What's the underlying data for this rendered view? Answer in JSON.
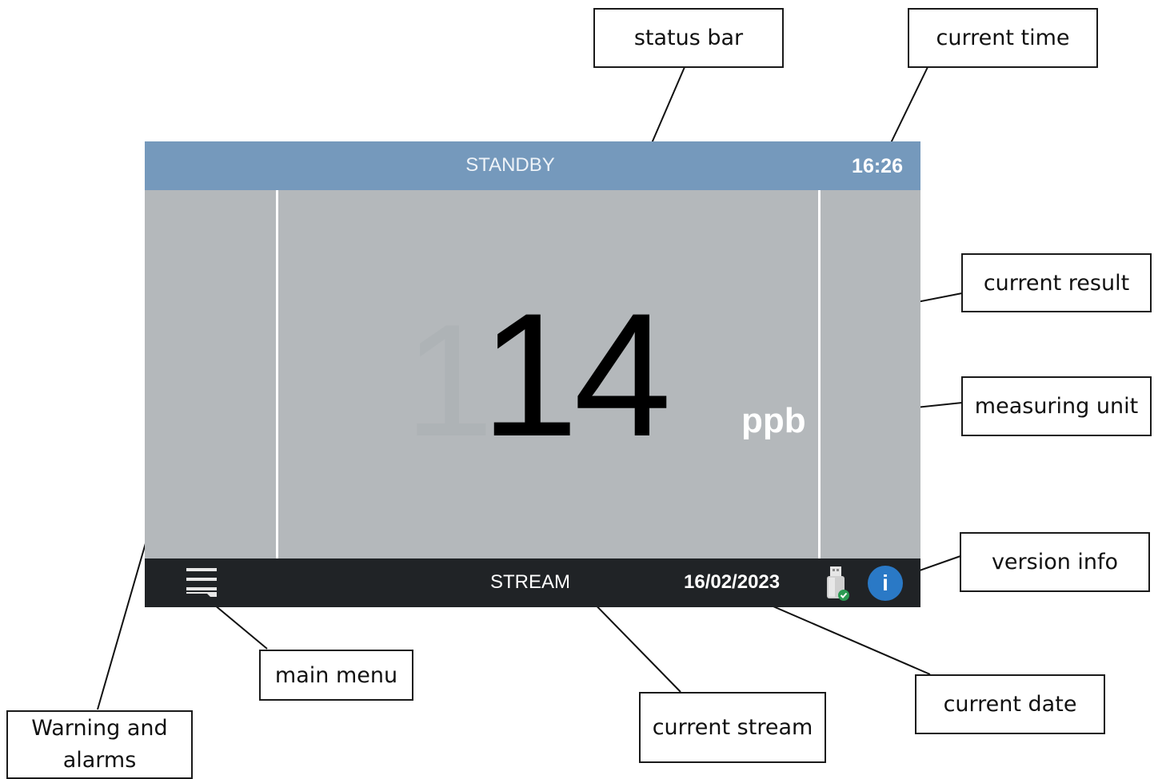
{
  "status_bar": {
    "status": "STANDBY",
    "time": "16:26",
    "color": "#7599bc"
  },
  "main": {
    "ghost_digit": "1",
    "result": "14",
    "unit": "ppb",
    "background": "#b4b8bb"
  },
  "bottom_bar": {
    "stream": "STREAM",
    "date": "16/02/2023",
    "menu_icon": "hamburger-menu-icon",
    "usb_icon": "usb-drive-icon",
    "info_icon": "info-icon",
    "info_symbol": "i",
    "background": "#202326",
    "info_color": "#2a79c6"
  },
  "callouts": {
    "status_bar": "status bar",
    "current_time": "current time",
    "current_result": "current result",
    "measuring_unit": "measuring unit",
    "version_info": "version info",
    "main_menu": "main menu",
    "current_stream": "current stream",
    "current_date": "current date",
    "warnings": "Warning and alarms"
  }
}
